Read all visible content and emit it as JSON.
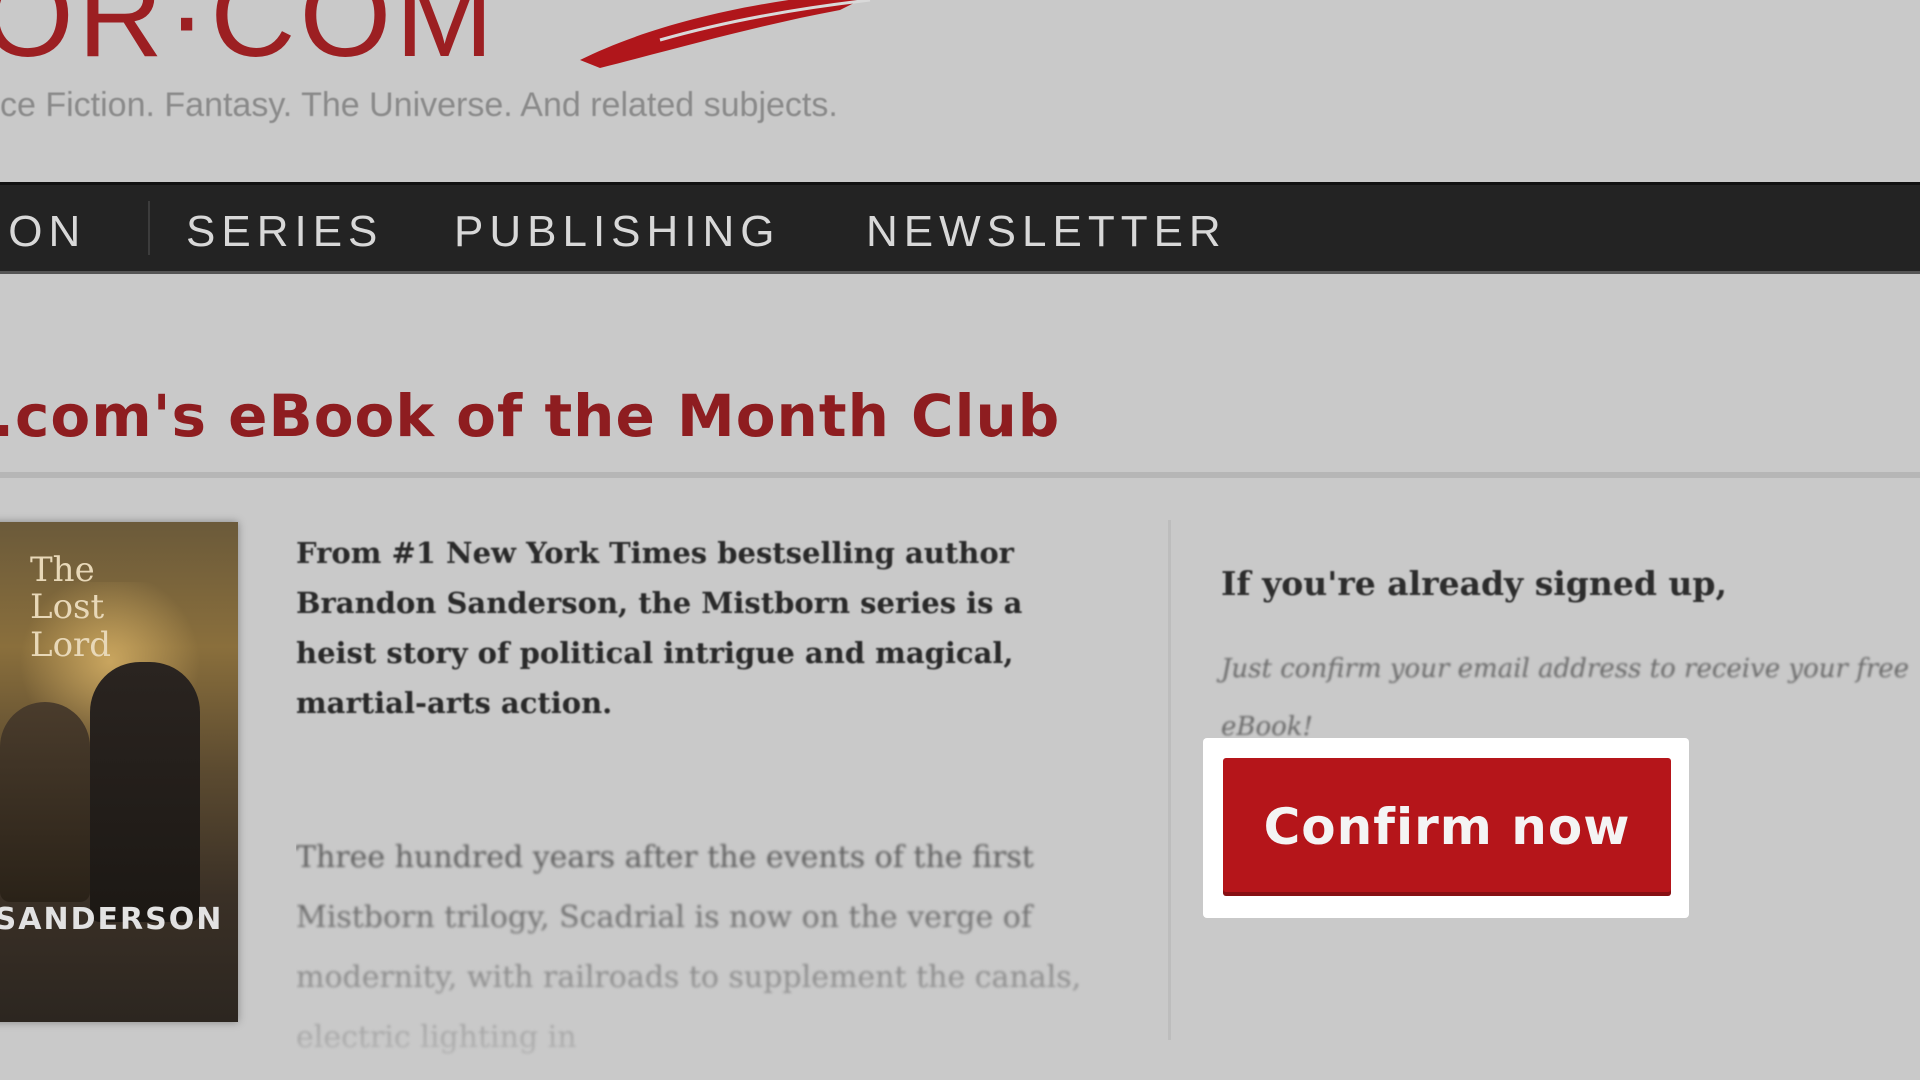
{
  "header": {
    "logo_text": "OR·COM",
    "tagline": "ce Fiction. Fantasy. The Universe. And related subjects."
  },
  "nav": {
    "items": [
      {
        "label": "ION"
      },
      {
        "label": "SERIES"
      },
      {
        "label": "PUBLISHING"
      },
      {
        "label": "NEWSLETTER"
      }
    ]
  },
  "section": {
    "title": ".com's eBook of the Month Club"
  },
  "book": {
    "cover_title": "The\nLost\nLord",
    "cover_author": "SANDERSON"
  },
  "description": {
    "bold_paragraph": "From #1 New York Times bestselling author Brandon Sanderson, the Mistborn series is a heist story of political intrigue and magical, martial-arts action.",
    "faded_paragraph": "Three hundred years after the events of the first Mistborn trilogy, Scadrial is now on the verge of modernity, with railroads to supplement the canals, electric lighting in"
  },
  "signup": {
    "heading": "If you're already signed up,",
    "body": "Just confirm your email address to receive your free eBook!",
    "confirm_label": "Confirm now"
  },
  "colors": {
    "brand_red": "#b5151a",
    "heading_red": "#8e1d20",
    "navbar_bg": "#232323"
  }
}
